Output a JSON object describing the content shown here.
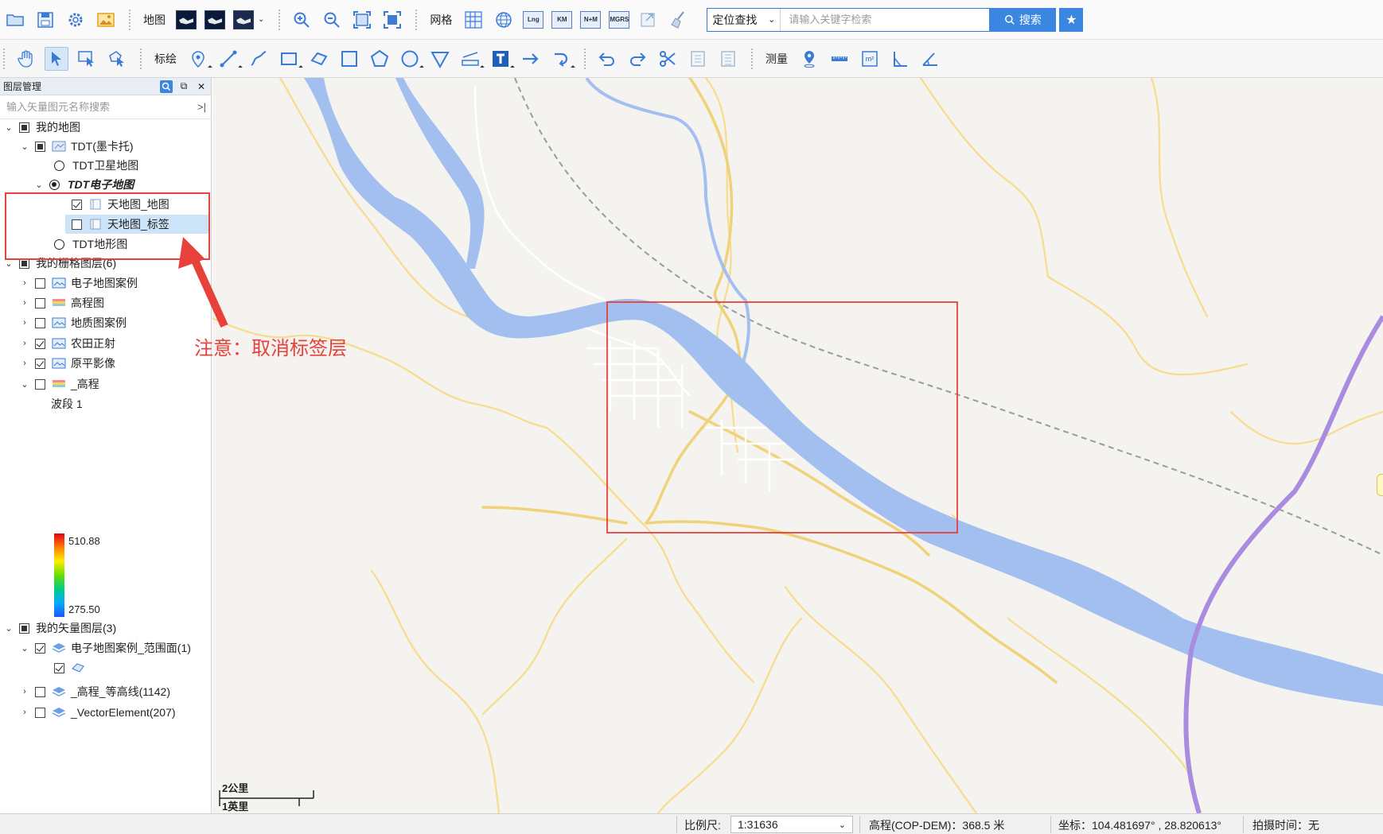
{
  "toolbar1": {
    "map_label": "地图",
    "grid_label": "网格",
    "grid_badges": [
      "Lng",
      "KM",
      "N+M",
      "MGRS"
    ],
    "search": {
      "mode_value": "定位查找",
      "placeholder": "请输入关键字检索",
      "button_label": "搜索"
    }
  },
  "toolbar2": {
    "draw_label": "标绘",
    "measure_label": "测量",
    "area_unit": "m²"
  },
  "panel": {
    "title": "图层管理",
    "search_placeholder": "输入矢量图元名称搜索"
  },
  "tree": {
    "my_map": "我的地图",
    "tdt_mercator": "TDT(墨卡托)",
    "tdt_satellite": "TDT卫星地图",
    "tdt_electronic": "TDT电子地图",
    "tianditu_map": "天地图_地图",
    "tianditu_label": "天地图_标签",
    "tdt_terrain": "TDT地形图",
    "raster_group": "我的栅格图层(6)",
    "raster_items": [
      "电子地图案例",
      "高程图",
      "地质图案例",
      "农田正射",
      "原平影像",
      "_高程"
    ],
    "band_label": "波段 1",
    "legend_max": "510.88",
    "legend_min": "275.50",
    "vector_group": "我的矢量图层(3)",
    "vector_items": [
      "电子地图案例_范围面(1)",
      "_高程_等高线(1142)",
      "_VectorElement(207)"
    ]
  },
  "annotation": {
    "note": "注意：取消标签层"
  },
  "map": {
    "scale_km": "2公里",
    "scale_mi": "1英里"
  },
  "status": {
    "scale_label": "比例尺:",
    "scale_value": "1:31636",
    "elevation": "高程(COP-DEM)：368.5 米",
    "coordinate": "坐标：104.481697° , 28.820613°",
    "capture_time": "拍摄时间：无"
  },
  "colors": {
    "accent": "#3b86e0",
    "annotation_red": "#e8403b",
    "river": "#a3bff0",
    "road": "#f6dc8c",
    "highway": "#a98be0"
  }
}
